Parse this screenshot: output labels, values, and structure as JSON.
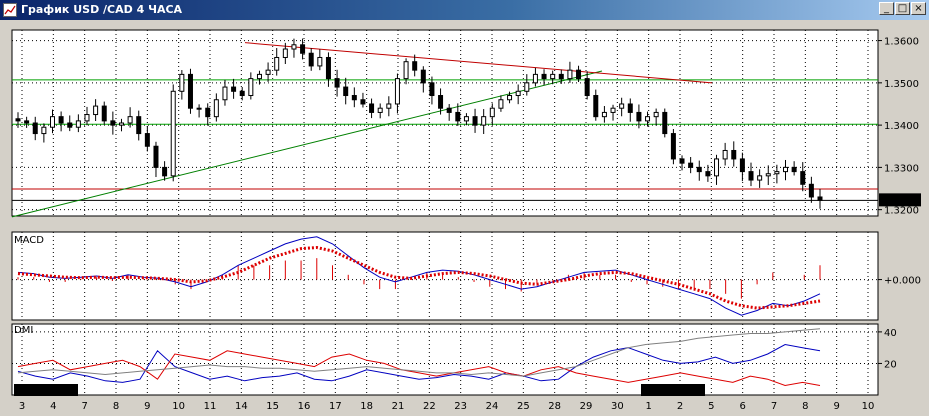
{
  "window": {
    "title": "График USD /CAD  4 ЧАСА",
    "minimize_glyph": "_",
    "maximize_glyph": "□",
    "close_glyph": "×",
    "icon": "chart-window-icon"
  },
  "chart_data": [
    {
      "type": "candlestick",
      "pair": "USD /CAD",
      "timeframe": "4 ЧАСА",
      "ylim": [
        1.3185,
        1.3625
      ],
      "y_ticks": [
        "1.3600",
        "1.3500",
        "1.3400",
        "1.3300",
        "1.3200"
      ],
      "current_price": "1.3222",
      "grid": true,
      "horizontal_levels": [
        {
          "value": 1.3507,
          "color": "#00a000"
        },
        {
          "value": 1.3402,
          "color": "#00a000"
        },
        {
          "value": 1.3249,
          "color": "#c00000"
        },
        {
          "value": 1.3222,
          "color": "#000000"
        }
      ],
      "trendlines": [
        {
          "from": [
            0,
            1.3183
          ],
          "to": [
            590,
            1.3528
          ],
          "color": "#008000"
        },
        {
          "from": [
            233,
            1.3595
          ],
          "to": [
            700,
            1.35
          ],
          "color": "#c00000"
        }
      ],
      "x_labels": [
        "3",
        "4",
        "7",
        "8",
        "9",
        "10",
        "11",
        "14",
        "15",
        "16",
        "17",
        "18",
        "21",
        "22",
        "23",
        "24",
        "25",
        "28",
        "29",
        "30",
        "1",
        "2",
        "5",
        "6",
        "7",
        "8",
        "9",
        "10"
      ],
      "month_labels": [
        "Ноя 2016",
        "Дек 2016"
      ],
      "series_close": [
        1.341,
        1.3405,
        1.338,
        1.3395,
        1.342,
        1.3405,
        1.3395,
        1.341,
        1.3425,
        1.3445,
        1.341,
        1.34,
        1.3405,
        1.342,
        1.338,
        1.335,
        1.33,
        1.328,
        1.348,
        1.352,
        1.344,
        1.344,
        1.342,
        1.346,
        1.349,
        1.348,
        1.347,
        1.351,
        1.352,
        1.353,
        1.356,
        1.358,
        1.359,
        1.357,
        1.354,
        1.356,
        1.351,
        1.349,
        1.347,
        1.346,
        1.345,
        1.343,
        1.344,
        1.345,
        1.351,
        1.355,
        1.353,
        1.35,
        1.347,
        1.344,
        1.343,
        1.341,
        1.342,
        1.34,
        1.342,
        1.344,
        1.346,
        1.347,
        1.348,
        1.35,
        1.352,
        1.351,
        1.352,
        1.351,
        1.353,
        1.351,
        1.347,
        1.342,
        1.343,
        1.344,
        1.345,
        1.343,
        1.341,
        1.342,
        1.343,
        1.338,
        1.332,
        1.331,
        1.33,
        1.329,
        1.328,
        1.332,
        1.334,
        1.332,
        1.329,
        1.327,
        1.328,
        1.3285,
        1.329,
        1.33,
        1.329,
        1.326,
        1.323,
        1.3222
      ]
    },
    {
      "type": "line",
      "title": "MACD",
      "y_tick": "+0.000",
      "series": [
        {
          "color": "#0000c0",
          "values": [
            0.3,
            0.25,
            0.1,
            0.05,
            0.1,
            0.15,
            0.05,
            0.2,
            0.1,
            0.05,
            -0.1,
            -0.3,
            -0.1,
            0.2,
            0.6,
            0.9,
            1.2,
            1.5,
            1.7,
            1.8,
            1.5,
            1.0,
            0.5,
            0.1,
            -0.1,
            0.1,
            0.3,
            0.4,
            0.35,
            0.2,
            0.0,
            -0.2,
            -0.4,
            -0.3,
            -0.1,
            0.1,
            0.3,
            0.35,
            0.4,
            0.2,
            0.0,
            -0.2,
            -0.4,
            -0.6,
            -0.8,
            -1.2,
            -1.5,
            -1.3,
            -1.0,
            -1.1,
            -0.9,
            -0.6
          ]
        },
        {
          "color": "#dd0000",
          "values": [
            0.25,
            0.2,
            0.15,
            0.1,
            0.08,
            0.1,
            0.08,
            0.1,
            0.08,
            0.05,
            0.0,
            -0.1,
            -0.05,
            0.1,
            0.3,
            0.6,
            0.9,
            1.1,
            1.3,
            1.35,
            1.2,
            0.9,
            0.6,
            0.3,
            0.1,
            0.05,
            0.15,
            0.25,
            0.3,
            0.25,
            0.15,
            0.0,
            -0.15,
            -0.2,
            -0.1,
            0.0,
            0.15,
            0.25,
            0.3,
            0.25,
            0.1,
            -0.05,
            -0.2,
            -0.4,
            -0.6,
            -0.9,
            -1.1,
            -1.2,
            -1.15,
            -1.1,
            -1.0,
            -0.9
          ]
        }
      ]
    },
    {
      "type": "line",
      "title": "DMI",
      "y_ticks": [
        "40",
        "20"
      ],
      "ylim": [
        0,
        45
      ],
      "series": [
        {
          "color": "#0000c0",
          "values": [
            15,
            12,
            10,
            14,
            12,
            9,
            8,
            10,
            28,
            18,
            14,
            10,
            12,
            9,
            11,
            12,
            14,
            10,
            9,
            12,
            16,
            14,
            12,
            10,
            11,
            13,
            12,
            10,
            14,
            12,
            9,
            10,
            18,
            24,
            28,
            30,
            26,
            22,
            20,
            21,
            24,
            20,
            22,
            26,
            32,
            30,
            28
          ]
        },
        {
          "color": "#dd0000",
          "values": [
            18,
            20,
            22,
            16,
            18,
            20,
            22,
            18,
            10,
            26,
            24,
            22,
            28,
            26,
            24,
            22,
            20,
            18,
            24,
            26,
            22,
            20,
            16,
            14,
            12,
            14,
            16,
            18,
            14,
            12,
            16,
            18,
            14,
            12,
            10,
            8,
            10,
            12,
            14,
            12,
            10,
            8,
            12,
            10,
            6,
            8,
            6
          ]
        },
        {
          "color": "#808080",
          "values": [
            14,
            15,
            16,
            15,
            14,
            13,
            14,
            15,
            16,
            17,
            18,
            19,
            18,
            18,
            17,
            17,
            16,
            15,
            16,
            17,
            18,
            17,
            16,
            15,
            14,
            14,
            13,
            14,
            13,
            12,
            14,
            16,
            18,
            22,
            26,
            30,
            32,
            33,
            34,
            36,
            37,
            38,
            39,
            39,
            40,
            41,
            42
          ]
        }
      ]
    }
  ]
}
